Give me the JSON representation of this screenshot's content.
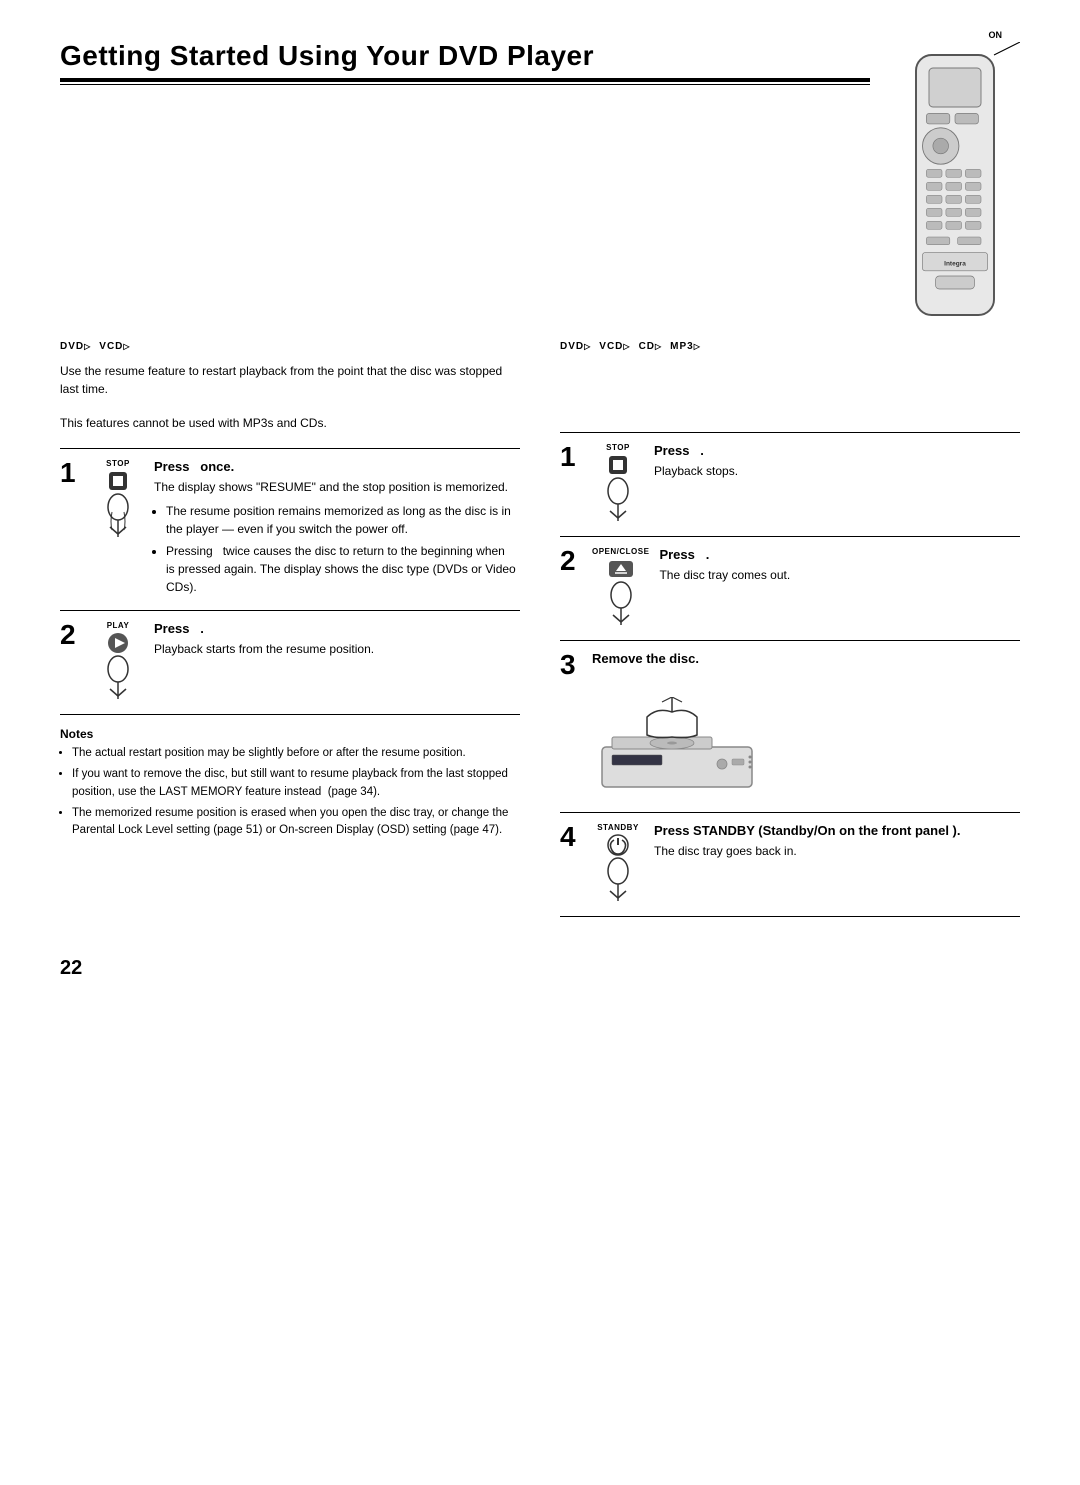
{
  "page": {
    "title": "Getting Started Using Your DVD Player",
    "page_number": "22"
  },
  "header": {
    "on_label": "ON"
  },
  "left_section": {
    "disc_types": [
      "DVD",
      "VCD"
    ],
    "intro": [
      "Use the resume feature to restart playback from the point that the disc was stopped last time.",
      "This features cannot be used with MP3s and CDs."
    ],
    "steps": [
      {
        "num": "1",
        "button_label": "STOP",
        "title": "Press  once.",
        "desc": "The display shows \"RESUME\" and the stop position is memorized.",
        "bullets": [
          "The resume position remains memorized as long as the disc is in the player — even if you switch the power off.",
          "Pressing  twice causes the disc to return to the beginning when  is pressed again. The display shows the disc type (DVDs or Video CDs)."
        ]
      },
      {
        "num": "2",
        "button_label": "PLAY",
        "title": "Press  .",
        "desc": "Playback starts from the resume position."
      }
    ],
    "notes": {
      "title": "Notes",
      "items": [
        "The actual restart position may be slightly before or after the resume position.",
        "If you want to remove the disc, but still want to resume playback from the last stopped position, use the LAST MEMORY feature instead  (page 34).",
        "The memorized resume position is erased when you open the disc tray, or change the Parental Lock Level setting (page 51) or On-screen Display (OSD) setting (page 47)."
      ]
    }
  },
  "right_section": {
    "disc_types": [
      "DVD",
      "VCD",
      "CD",
      "MP3"
    ],
    "steps": [
      {
        "num": "1",
        "button_label": "STOP",
        "title": "Press  .",
        "desc": "Playback stops."
      },
      {
        "num": "2",
        "button_label": "OPEN/CLOSE",
        "title": "Press  .",
        "desc": "The disc tray comes out."
      },
      {
        "num": "3",
        "title": "Remove the disc.",
        "desc": ""
      },
      {
        "num": "4",
        "button_label": "STANDBY",
        "title": "Press STANDBY (Standby/On on the front panel ).",
        "desc": "The disc tray goes back in."
      }
    ]
  }
}
